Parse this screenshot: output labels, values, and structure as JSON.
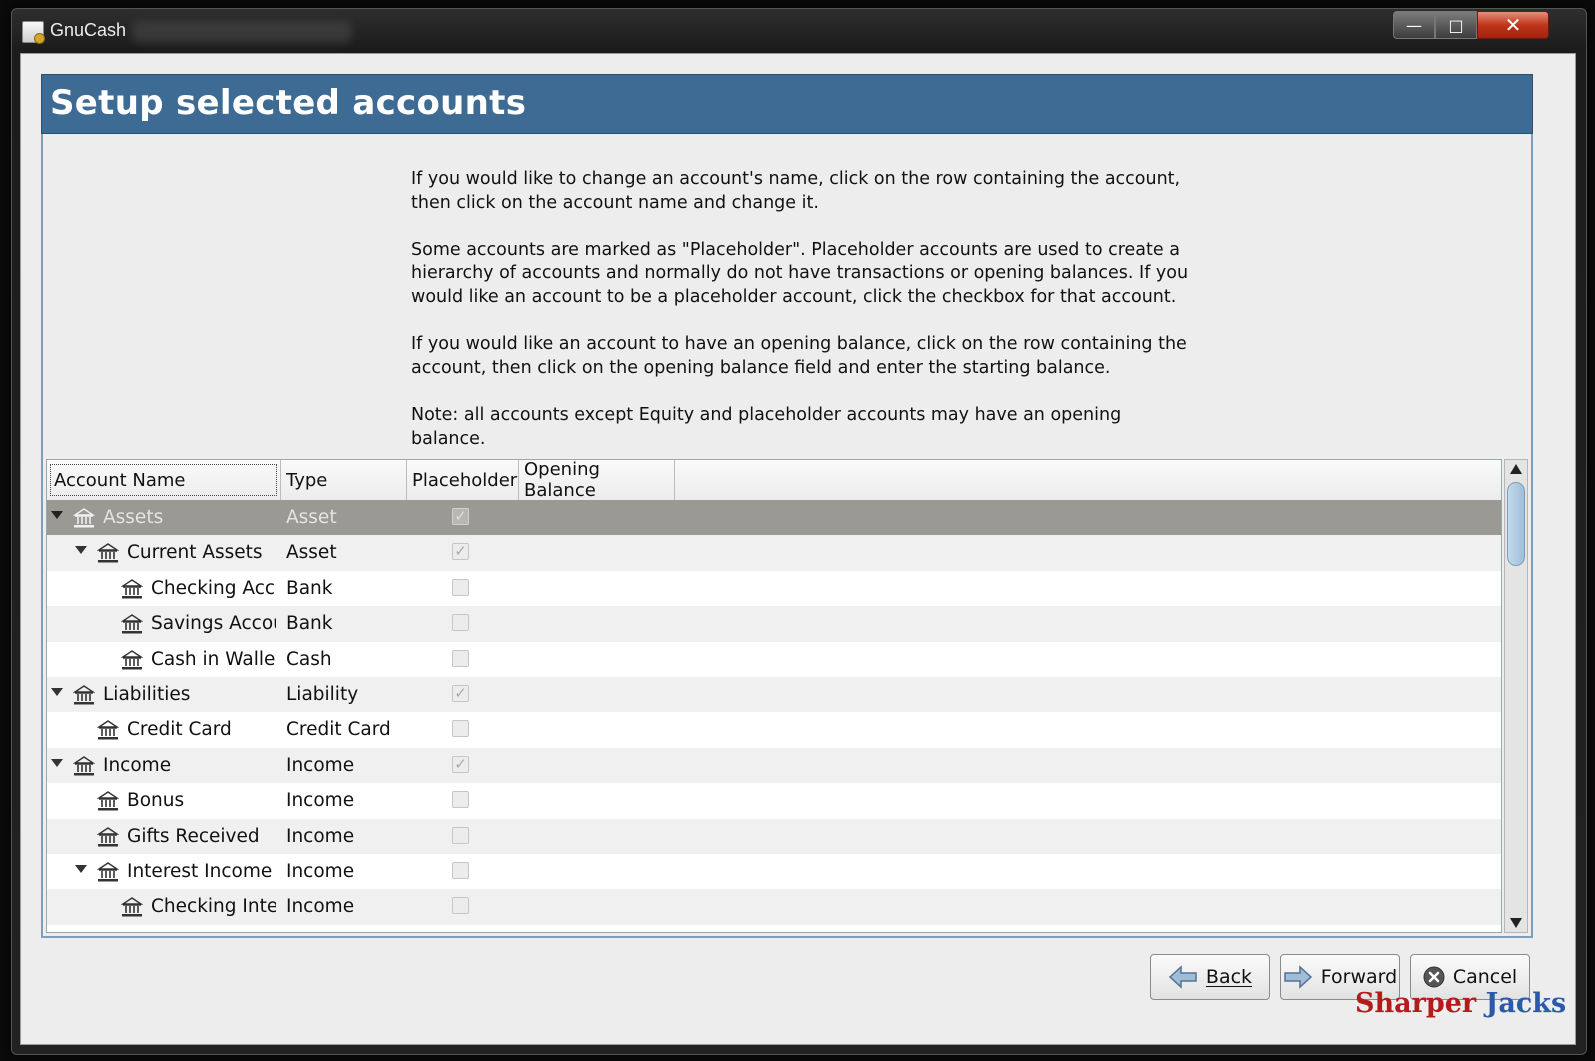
{
  "window": {
    "title": "GnuCash"
  },
  "header": {
    "title": "Setup selected accounts"
  },
  "instructions": [
    "If you would like to change an account's name, click on the row containing the account, then click on the account name and change it.",
    "Some accounts are marked as \"Placeholder\". Placeholder accounts are used to create a hierarchy of accounts and normally do not have transactions or opening balances. If you would like an account to be a placeholder account, click the checkbox for that account.",
    "If you would like an account to have an opening balance, click on the row containing the account, then click on the opening balance field and enter the starting balance.",
    "Note: all accounts except Equity and placeholder accounts may have an opening balance."
  ],
  "tree": {
    "columns": [
      "Account Name",
      "Type",
      "Placeholder",
      "Opening Balance"
    ],
    "rows": [
      {
        "name": "Assets",
        "type": "Asset",
        "level": 0,
        "expanded": true,
        "placeholder": true,
        "selected": true
      },
      {
        "name": "Current Assets",
        "type": "Asset",
        "level": 1,
        "expanded": true,
        "placeholder": true
      },
      {
        "name": "Checking Account",
        "type": "Bank",
        "level": 2,
        "placeholder": false
      },
      {
        "name": "Savings Account",
        "type": "Bank",
        "level": 2,
        "placeholder": false
      },
      {
        "name": "Cash in Wallet",
        "type": "Cash",
        "level": 2,
        "placeholder": false
      },
      {
        "name": "Liabilities",
        "type": "Liability",
        "level": 0,
        "expanded": true,
        "placeholder": true
      },
      {
        "name": "Credit Card",
        "type": "Credit Card",
        "level": 1,
        "placeholder": false
      },
      {
        "name": "Income",
        "type": "Income",
        "level": 0,
        "expanded": true,
        "placeholder": true
      },
      {
        "name": "Bonus",
        "type": "Income",
        "level": 1,
        "placeholder": false
      },
      {
        "name": "Gifts Received",
        "type": "Income",
        "level": 1,
        "placeholder": false
      },
      {
        "name": "Interest Income",
        "type": "Income",
        "level": 1,
        "expanded": true,
        "placeholder": false
      },
      {
        "name": "Checking Interest",
        "type": "Income",
        "level": 2,
        "placeholder": false
      }
    ]
  },
  "buttons": {
    "back": "Back",
    "forward": "Forward",
    "cancel": "Cancel"
  },
  "watermark": {
    "part1": "Sharper",
    "part2": "Jacks"
  },
  "icons": {
    "account": "bank-icon",
    "expander": "expander-triangle-icon"
  },
  "colors": {
    "header_bar": "#3e6b94",
    "selected_row": "#9a9994"
  }
}
